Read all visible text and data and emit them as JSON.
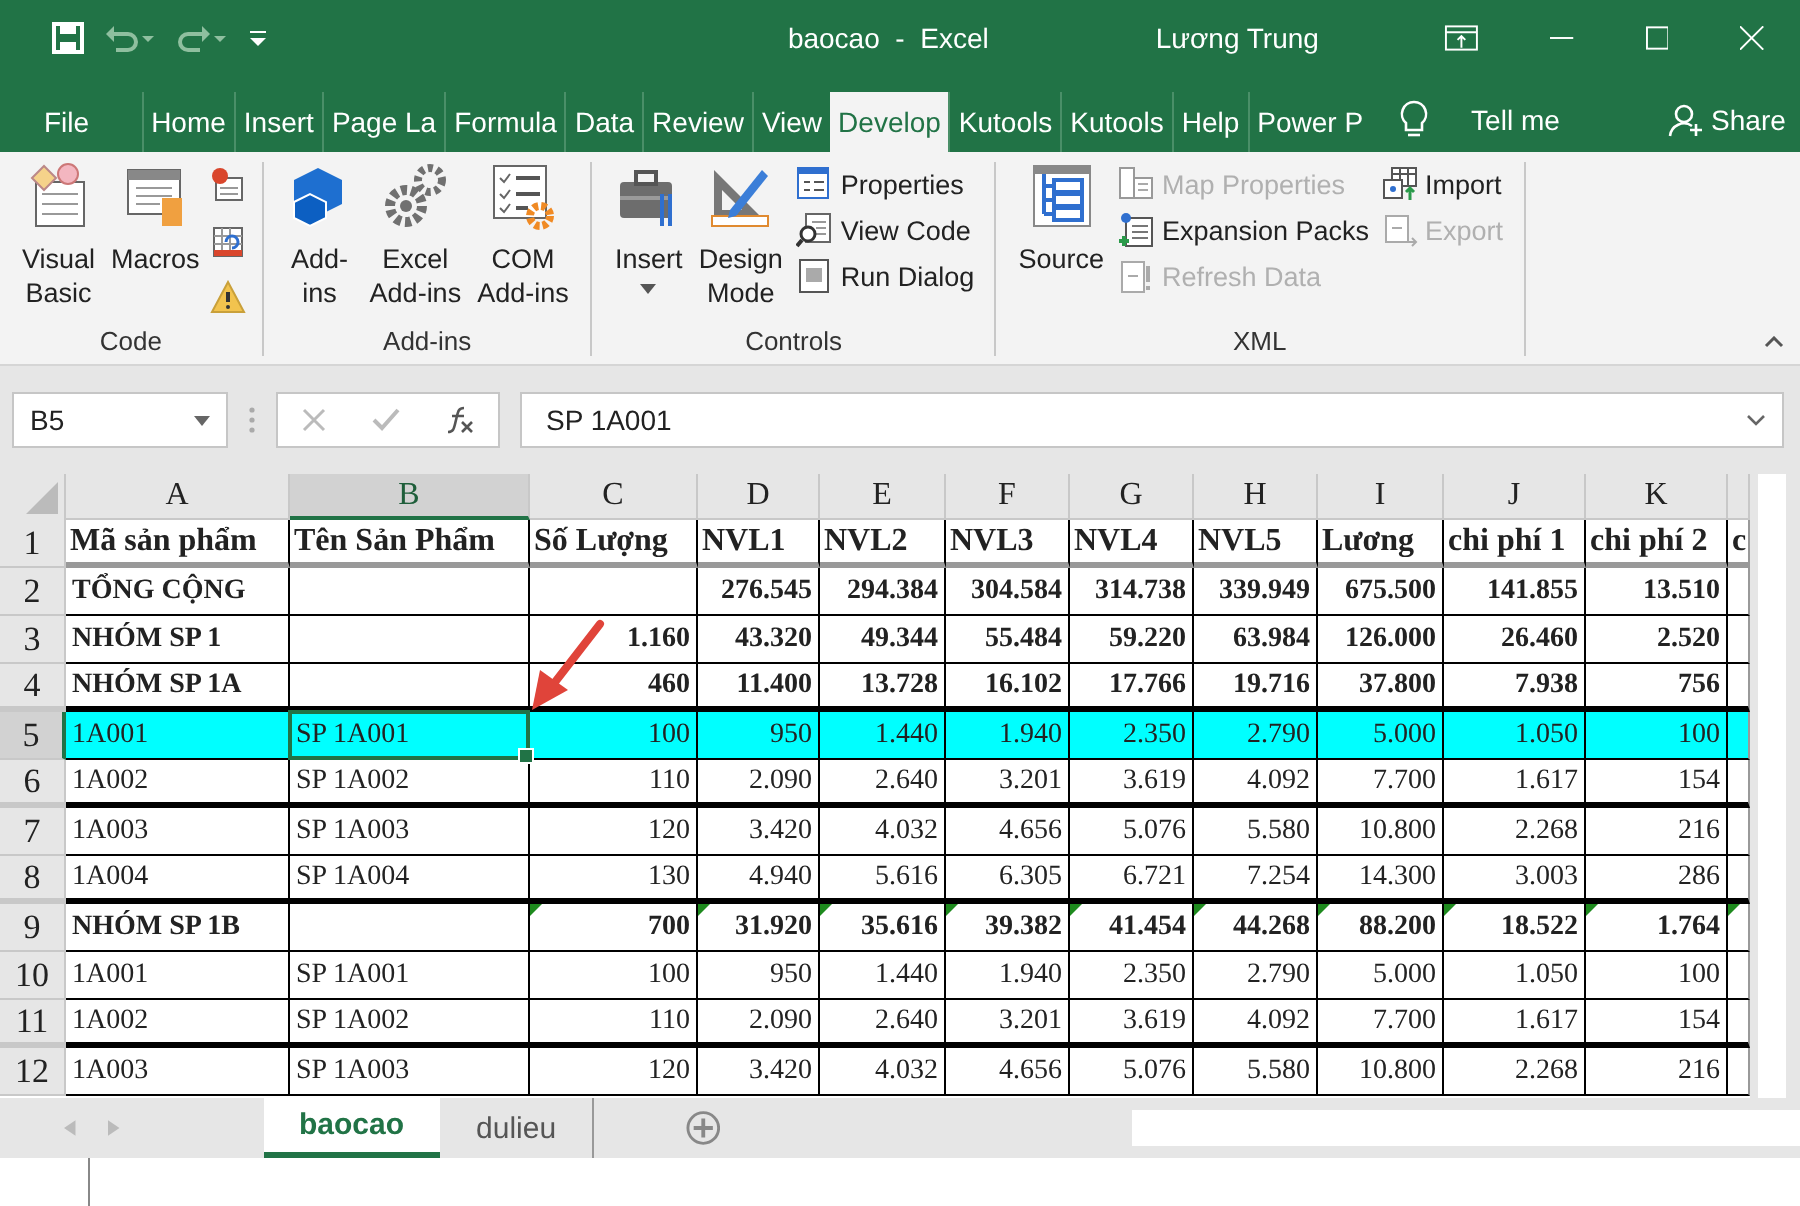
{
  "window": {
    "title": "baocao  -  Excel",
    "user": "Lương Trung"
  },
  "tabs": [
    {
      "label": "File",
      "selected": false
    },
    {
      "label": "Home",
      "selected": false
    },
    {
      "label": "Insert",
      "selected": false
    },
    {
      "label": "Page La",
      "selected": false
    },
    {
      "label": "Formula",
      "selected": false
    },
    {
      "label": "Data",
      "selected": false
    },
    {
      "label": "Review",
      "selected": false
    },
    {
      "label": "View",
      "selected": false
    },
    {
      "label": "Develop",
      "selected": true
    },
    {
      "label": "Kutools",
      "selected": false
    },
    {
      "label": "Kutools",
      "selected": false
    },
    {
      "label": "Help",
      "selected": false
    },
    {
      "label": "Power P",
      "selected": false
    }
  ],
  "tell_me": "Tell me",
  "share": "Share",
  "ribbon": {
    "groups": [
      {
        "name": "Code",
        "buttons": [
          {
            "kind": "large",
            "lines": [
              "Visual",
              "Basic"
            ],
            "dropdown": false,
            "disabled": false
          },
          {
            "kind": "large",
            "lines": [
              "Macros"
            ],
            "dropdown": false,
            "disabled": false
          },
          {
            "kind": "icon",
            "disabled": false
          },
          {
            "kind": "icon",
            "disabled": false
          },
          {
            "kind": "icon",
            "disabled": false
          }
        ]
      },
      {
        "name": "Add-ins",
        "buttons": [
          {
            "kind": "large",
            "lines": [
              "Add-",
              "ins"
            ],
            "dropdown": false,
            "disabled": false
          },
          {
            "kind": "large",
            "lines": [
              "Excel",
              "Add-ins"
            ],
            "dropdown": false,
            "disabled": false
          },
          {
            "kind": "large",
            "lines": [
              "COM",
              "Add-ins"
            ],
            "dropdown": false,
            "disabled": false
          }
        ]
      },
      {
        "name": "Controls",
        "buttons": [
          {
            "kind": "large",
            "lines": [
              "Insert"
            ],
            "dropdown": true,
            "disabled": false
          },
          {
            "kind": "large",
            "lines": [
              "Design",
              "Mode"
            ],
            "dropdown": false,
            "disabled": false
          },
          {
            "kind": "small",
            "label": "Properties",
            "disabled": false
          },
          {
            "kind": "small",
            "label": "View Code",
            "disabled": false
          },
          {
            "kind": "small",
            "label": "Run Dialog",
            "disabled": false
          }
        ]
      },
      {
        "name": "XML",
        "buttons": [
          {
            "kind": "large",
            "lines": [
              "Source"
            ],
            "dropdown": false,
            "disabled": false
          },
          {
            "kind": "small",
            "label": "Map Properties",
            "disabled": true
          },
          {
            "kind": "small",
            "label": "Expansion Packs",
            "disabled": false
          },
          {
            "kind": "small",
            "label": "Refresh Data",
            "disabled": true
          },
          {
            "kind": "small",
            "label": "Import",
            "disabled": false
          },
          {
            "kind": "small",
            "label": "Export",
            "disabled": true
          }
        ]
      }
    ]
  },
  "formula_bar": {
    "name_box": "B5",
    "value": "SP 1A001"
  },
  "columns": [
    {
      "label": "A",
      "selected": false
    },
    {
      "label": "B",
      "selected": true
    },
    {
      "label": "C",
      "selected": false
    },
    {
      "label": "D",
      "selected": false
    },
    {
      "label": "E",
      "selected": false
    },
    {
      "label": "F",
      "selected": false
    },
    {
      "label": "G",
      "selected": false
    },
    {
      "label": "H",
      "selected": false
    },
    {
      "label": "I",
      "selected": false
    },
    {
      "label": "J",
      "selected": false
    },
    {
      "label": "K",
      "selected": false
    }
  ],
  "rows": [
    {
      "number": "1",
      "kind": "header",
      "selected": false,
      "highlighted": false,
      "flagged": false,
      "thick_bottom": false,
      "cells": [
        "Mã sản phẩm",
        "Tên Sản Phẩm",
        "Số Lượng",
        "NVL1",
        "NVL2",
        "NVL3",
        "NVL4",
        "NVL5",
        "Lương",
        "chi phí 1",
        "chi phí 2",
        "c"
      ]
    },
    {
      "number": "2",
      "kind": "group",
      "selected": false,
      "highlighted": false,
      "flagged": false,
      "thick_bottom": false,
      "cells": [
        "TỔNG CỘNG",
        "",
        "",
        "276.545",
        "294.384",
        "304.584",
        "314.738",
        "339.949",
        "675.500",
        "141.855",
        "13.510"
      ]
    },
    {
      "number": "3",
      "kind": "group",
      "selected": false,
      "highlighted": false,
      "flagged": false,
      "thick_bottom": false,
      "cells": [
        "NHÓM SP 1",
        "",
        "1.160",
        "43.320",
        "49.344",
        "55.484",
        "59.220",
        "63.984",
        "126.000",
        "26.460",
        "2.520"
      ]
    },
    {
      "number": "4",
      "kind": "group",
      "selected": false,
      "highlighted": false,
      "flagged": false,
      "thick_bottom": true,
      "cells": [
        "NHÓM SP 1A",
        "",
        "460",
        "11.400",
        "13.728",
        "16.102",
        "17.766",
        "19.716",
        "37.800",
        "7.938",
        "756"
      ]
    },
    {
      "number": "5",
      "kind": "item",
      "selected": true,
      "highlighted": true,
      "flagged": false,
      "thick_bottom": false,
      "cells": [
        "1A001",
        "SP 1A001",
        "100",
        "950",
        "1.440",
        "1.940",
        "2.350",
        "2.790",
        "5.000",
        "1.050",
        "100"
      ]
    },
    {
      "number": "6",
      "kind": "item",
      "selected": false,
      "highlighted": false,
      "flagged": false,
      "thick_bottom": true,
      "cells": [
        "1A002",
        "SP 1A002",
        "110",
        "2.090",
        "2.640",
        "3.201",
        "3.619",
        "4.092",
        "7.700",
        "1.617",
        "154"
      ]
    },
    {
      "number": "7",
      "kind": "item",
      "selected": false,
      "highlighted": false,
      "flagged": false,
      "thick_bottom": false,
      "cells": [
        "1A003",
        "SP 1A003",
        "120",
        "3.420",
        "4.032",
        "4.656",
        "5.076",
        "5.580",
        "10.800",
        "2.268",
        "216"
      ]
    },
    {
      "number": "8",
      "kind": "item",
      "selected": false,
      "highlighted": false,
      "flagged": false,
      "thick_bottom": true,
      "cells": [
        "1A004",
        "SP 1A004",
        "130",
        "4.940",
        "5.616",
        "6.305",
        "6.721",
        "7.254",
        "14.300",
        "3.003",
        "286"
      ]
    },
    {
      "number": "9",
      "kind": "group",
      "selected": false,
      "highlighted": false,
      "flagged": true,
      "thick_bottom": false,
      "cells": [
        "NHÓM SP 1B",
        "",
        "700",
        "31.920",
        "35.616",
        "39.382",
        "41.454",
        "44.268",
        "88.200",
        "18.522",
        "1.764"
      ]
    },
    {
      "number": "10",
      "kind": "item",
      "selected": false,
      "highlighted": false,
      "flagged": false,
      "thick_bottom": false,
      "cells": [
        "1A001",
        "SP 1A001",
        "100",
        "950",
        "1.440",
        "1.940",
        "2.350",
        "2.790",
        "5.000",
        "1.050",
        "100"
      ]
    },
    {
      "number": "11",
      "kind": "item",
      "selected": false,
      "highlighted": false,
      "flagged": false,
      "thick_bottom": true,
      "cells": [
        "1A002",
        "SP 1A002",
        "110",
        "2.090",
        "2.640",
        "3.201",
        "3.619",
        "4.092",
        "7.700",
        "1.617",
        "154"
      ]
    },
    {
      "number": "12",
      "kind": "item",
      "selected": false,
      "highlighted": false,
      "flagged": false,
      "thick_bottom": false,
      "cells": [
        "1A003",
        "SP 1A003",
        "120",
        "3.420",
        "4.032",
        "4.656",
        "5.076",
        "5.580",
        "10.800",
        "2.268",
        "216"
      ]
    }
  ],
  "sheets": [
    {
      "label": "baocao",
      "selected": true
    },
    {
      "label": "dulieu",
      "selected": false
    }
  ]
}
